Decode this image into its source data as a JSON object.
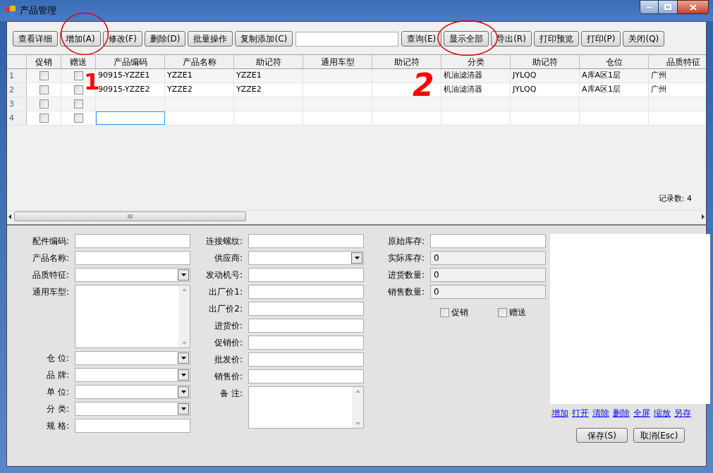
{
  "window": {
    "title": "产品管理"
  },
  "toolbar": [
    {
      "kind": "button",
      "label": "查看详细"
    },
    {
      "kind": "button",
      "label": "增加(A)"
    },
    {
      "kind": "button",
      "label": "修改(F)"
    },
    {
      "kind": "button",
      "label": "删除(D)"
    },
    {
      "kind": "button",
      "label": "批量操作"
    },
    {
      "kind": "button",
      "label": "复制添加(C)"
    },
    {
      "kind": "field"
    },
    {
      "kind": "button",
      "label": "查询(E)"
    },
    {
      "kind": "button",
      "label": "显示全部"
    },
    {
      "kind": "button",
      "label": "导出(R)"
    },
    {
      "kind": "button",
      "label": "打印预览"
    },
    {
      "kind": "button",
      "label": "打印(P)"
    },
    {
      "kind": "button",
      "label": "关闭(Q)"
    }
  ],
  "grid": {
    "checkbox_columns": [
      "促销",
      "赠送"
    ],
    "columns": [
      "产品编码",
      "产品名称",
      "助记符",
      "通用车型",
      "助记符",
      "分类",
      "助记符",
      "仓位",
      "品质特征"
    ],
    "rows": [
      {
        "number": "1",
        "promo": false,
        "gift": false,
        "editing": false,
        "cells": [
          "90915-YZZE1",
          "YZZE1",
          "YZZE1",
          null,
          null,
          "机油滤清器",
          "JYLQQ",
          "A库A区1层",
          "广州"
        ]
      },
      {
        "number": "2",
        "promo": false,
        "gift": false,
        "editing": false,
        "cells": [
          "90915-YZZE2",
          "YZZE2",
          "YZZE2",
          null,
          null,
          "机油滤清器",
          "JYLQQ",
          "A库A区1层",
          "广州"
        ]
      },
      {
        "number": "3",
        "promo": false,
        "gift": false,
        "editing": false,
        "cells": [
          null,
          null,
          null,
          null,
          null,
          null,
          null,
          null,
          null
        ]
      },
      {
        "number": "4",
        "promo": false,
        "gift": false,
        "editing": true,
        "cells": [
          null,
          null,
          null,
          null,
          null,
          null,
          null,
          null,
          null
        ]
      }
    ],
    "record_count": "记录数: 4"
  },
  "form": {
    "columns": [
      [
        {
          "label": "配件编码:",
          "kind": "text"
        },
        {
          "label": "产品名称:",
          "kind": "text"
        },
        {
          "label": "品质特征:",
          "kind": "combo"
        },
        {
          "label": "通用车型:",
          "kind": "memo"
        },
        {
          "label": "仓 位:",
          "kind": "combo"
        },
        {
          "label": "品 牌:",
          "kind": "combo"
        },
        {
          "label": "单 位:",
          "kind": "combo"
        },
        {
          "label": "分 类:",
          "kind": "combo"
        },
        {
          "label": "规 格:",
          "kind": "text"
        }
      ],
      [
        {
          "label": "连接螺纹:",
          "kind": "text"
        },
        {
          "label": "供应商:",
          "kind": "combo"
        },
        {
          "label": "发动机号:",
          "kind": "text"
        },
        {
          "label": "出厂价1:",
          "kind": "text"
        },
        {
          "label": "出厂价2:",
          "kind": "text"
        },
        {
          "label": "进货价:",
          "kind": "text"
        },
        {
          "label": "促销价:",
          "kind": "text"
        },
        {
          "label": "批发价:",
          "kind": "text"
        },
        {
          "label": "销售价:",
          "kind": "text"
        },
        {
          "label": "备 注:",
          "kind": "memo"
        }
      ],
      [
        {
          "label": "原始库存:",
          "kind": "text"
        },
        {
          "label": "实际库存:",
          "kind": "readonly",
          "value": "0"
        },
        {
          "label": "进货数量:",
          "kind": "readonly",
          "value": "0"
        },
        {
          "label": "销售数量:",
          "kind": "readonly",
          "value": "0"
        }
      ]
    ],
    "checkboxes": [
      {
        "label": "促销",
        "checked": false
      },
      {
        "label": "赠送",
        "checked": false
      }
    ],
    "image_links": [
      "增加",
      "打开",
      "清除",
      "删除",
      "全屏",
      "缩放",
      "另存"
    ],
    "buttons": [
      "保存(S)",
      "取消(Esc)"
    ]
  },
  "annotations": [
    {
      "kind": "circle"
    },
    {
      "kind": "circle"
    },
    {
      "kind": "mark",
      "text": "1"
    },
    {
      "kind": "mark",
      "text": "2"
    }
  ]
}
